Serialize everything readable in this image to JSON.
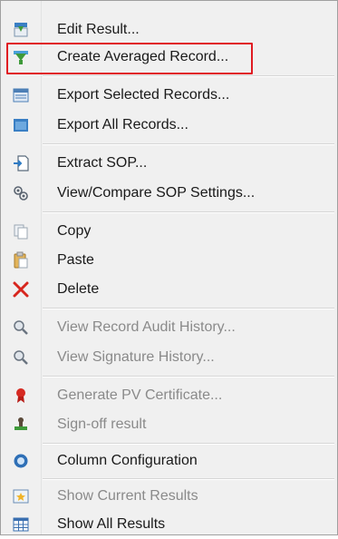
{
  "menu": {
    "items": [
      {
        "label": "Edit Result...",
        "icon": "edit-result-icon"
      },
      {
        "label": "Create Averaged Record...",
        "icon": "averaged-record-icon"
      },
      {
        "label": "Export Selected Records...",
        "icon": "export-selected-icon"
      },
      {
        "label": "Export All Records...",
        "icon": "export-all-icon"
      },
      {
        "label": "Extract SOP...",
        "icon": "extract-sop-icon"
      },
      {
        "label": "View/Compare SOP Settings...",
        "icon": "compare-sop-icon"
      },
      {
        "label": "Copy",
        "icon": "copy-icon"
      },
      {
        "label": "Paste",
        "icon": "paste-icon"
      },
      {
        "label": "Delete",
        "icon": "delete-icon"
      },
      {
        "label": "View Record Audit History...",
        "icon": "audit-history-icon",
        "disabled": true
      },
      {
        "label": "View Signature History...",
        "icon": "signature-history-icon",
        "disabled": true
      },
      {
        "label": "Generate PV Certificate...",
        "icon": "certificate-icon",
        "disabled": true
      },
      {
        "label": "Sign-off result",
        "icon": "stamp-icon",
        "disabled": true
      },
      {
        "label": "Column Configuration",
        "icon": "column-config-icon"
      },
      {
        "label": "Show Current Results",
        "icon": "current-results-icon",
        "disabled": true
      },
      {
        "label": "Show All Results",
        "icon": "all-results-icon"
      }
    ]
  },
  "highlight_color": "#e01b22"
}
